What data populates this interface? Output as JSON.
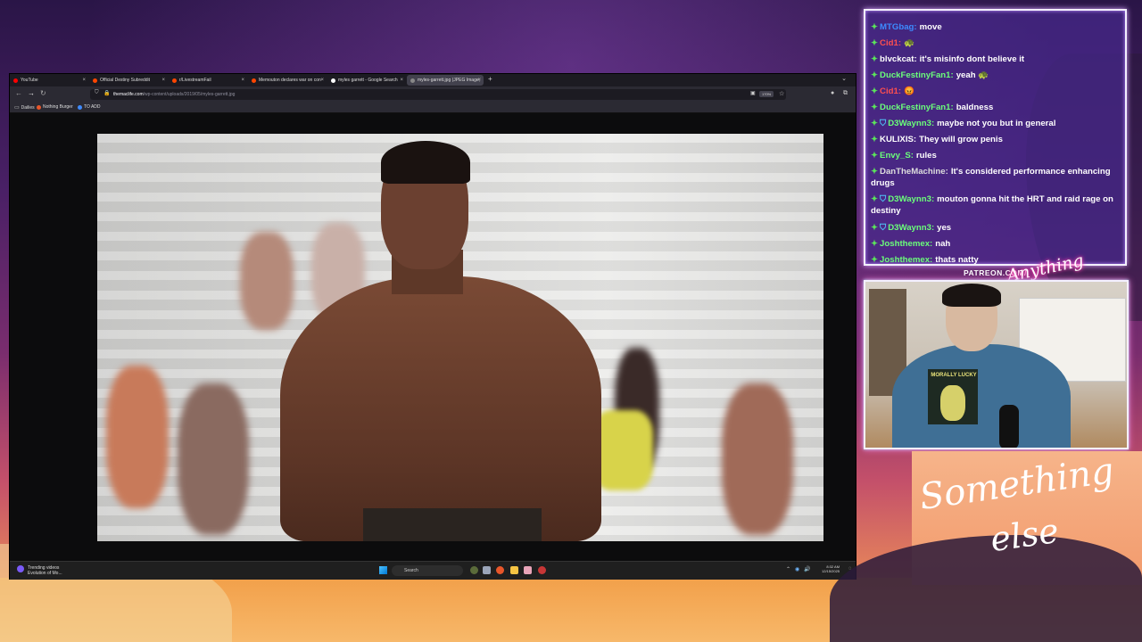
{
  "browser": {
    "tabs": [
      {
        "label": "YouTube",
        "color": "#ff0000"
      },
      {
        "label": "Official Destiny Subreddit",
        "color": "#ff4500"
      },
      {
        "label": "r/LivestreamFail",
        "color": "#ff4500"
      },
      {
        "label": "Memouton declares war on con",
        "color": "#ff4500"
      },
      {
        "label": "myles garrett - Google Search",
        "color": "#ffffff"
      },
      {
        "label": "myles-garrett.jpg (JPEG Image,",
        "color": "#888888"
      }
    ],
    "new_tab": "+",
    "tab_menu": "⌄",
    "url_host": "themaclife.com",
    "url_path": "/wp-content/uploads/2019/05/myles-garrett.jpg",
    "zoom": "170%",
    "bookmarks": [
      {
        "label": "Dailies",
        "icon": "folder-icon"
      },
      {
        "label": "Nothing Burger",
        "icon": "burger-icon"
      },
      {
        "label": "TO ADD",
        "icon": "globe-icon"
      }
    ]
  },
  "taskbar": {
    "news_line1": "Trending videos",
    "news_line2": "Evolution of Mo...",
    "search_label": "Search",
    "time": "8:32 AM",
    "date": "12/15/2025"
  },
  "chat": {
    "messages": [
      {
        "user": "MTGbag:",
        "text": "move",
        "color": "#3d8bff",
        "badge": "star"
      },
      {
        "user": "Cid1:",
        "text": "🐢",
        "color": "#ff4f4f",
        "badge": "star"
      },
      {
        "user": "blvckcat:",
        "text": "it's misinfo dont believe it",
        "color": "#ffffff",
        "badge": "star"
      },
      {
        "user": "DuckFestinyFan1:",
        "text": "yeah 🐢",
        "color": "#6bff7a",
        "badge": "star"
      },
      {
        "user": "Cid1:",
        "text": "😡",
        "color": "#ff4f4f",
        "badge": "star"
      },
      {
        "user": "DuckFestinyFan1:",
        "text": "baldness",
        "color": "#6bff7a",
        "badge": "star"
      },
      {
        "user": "D3Waynn3:",
        "text": "maybe not you but in general",
        "color": "#6bff7a",
        "badge": "star-shield"
      },
      {
        "user": "KULIXIS:",
        "text": "They will grow penis",
        "color": "#ffffff",
        "badge": "star"
      },
      {
        "user": "Envy_S:",
        "text": "rules",
        "color": "#6bff7a",
        "badge": "star"
      },
      {
        "user": "DanTheMachine:",
        "text": "It's considered performance enhancing drugs",
        "color": "#dddddd",
        "badge": "star"
      },
      {
        "user": "D3Waynn3:",
        "text": "mouton gonna hit the HRT and raid rage on destiny",
        "color": "#6bff7a",
        "badge": "star-shield"
      },
      {
        "user": "D3Waynn3:",
        "text": "yes",
        "color": "#6bff7a",
        "badge": "star-shield"
      },
      {
        "user": "Joshthemex:",
        "text": "nah",
        "color": "#6bff7a",
        "badge": "star"
      },
      {
        "user": "Joshthemex:",
        "text": "thats natty",
        "color": "#6bff7a",
        "badge": "star"
      }
    ]
  },
  "webcam": {
    "shirt_text": "MORALLY LUCKY"
  },
  "overlay": {
    "patreon": "PATREON.COM/",
    "patreon_handle_1": "Anything",
    "patreon_handle_2": "else",
    "logo_line1": "Something",
    "logo_line2": "else"
  }
}
